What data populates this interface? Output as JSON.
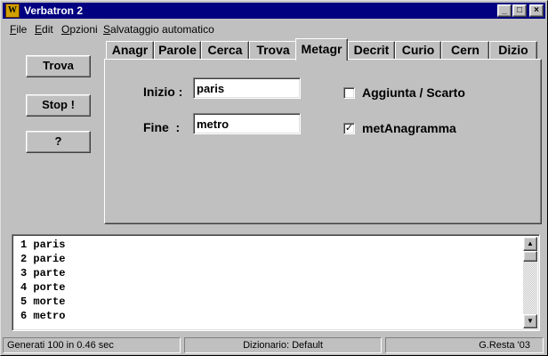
{
  "window": {
    "title": "Verbatron 2",
    "icon_label": "W"
  },
  "titlebar_buttons": {
    "minimize": "_",
    "maximize": "□",
    "close": "×"
  },
  "menu": [
    {
      "accel": "F",
      "rest": "ile"
    },
    {
      "accel": "E",
      "rest": "dit"
    },
    {
      "accel": "O",
      "rest": "pzioni"
    },
    {
      "accel": "S",
      "rest": "alvataggio automatico"
    }
  ],
  "side_buttons": {
    "trova": "Trova",
    "stop": "Stop !",
    "help": "?"
  },
  "tabs": [
    "Anagr",
    "Parole",
    "Cerca",
    "Trova",
    "Metagr",
    "Decrit",
    "Curio",
    "Cern",
    "Dizio"
  ],
  "active_tab": "Metagr",
  "form": {
    "inizio_label": "Inizio :",
    "inizio_value": "paris",
    "fine_label": "Fine  :",
    "fine_value": "metro",
    "aggiunta_label": "Aggiunta / Scarto",
    "aggiunta_checked": false,
    "metanagramma_label": "metAnagramma",
    "metanagramma_checked": true
  },
  "results": [
    "1 paris",
    "2 parie",
    "3 parte",
    "4 porte",
    "5 morte",
    "6 metro"
  ],
  "scrollbar": {
    "up": "▲",
    "down": "▼"
  },
  "status": {
    "generated": "Generati 100 in 0.46 sec",
    "dictionary": "Dizionario: Default",
    "credit": "G.Resta '03"
  },
  "colors": {
    "titlebar": "#000080",
    "face": "#c0c0c0",
    "field": "#ffffff"
  }
}
